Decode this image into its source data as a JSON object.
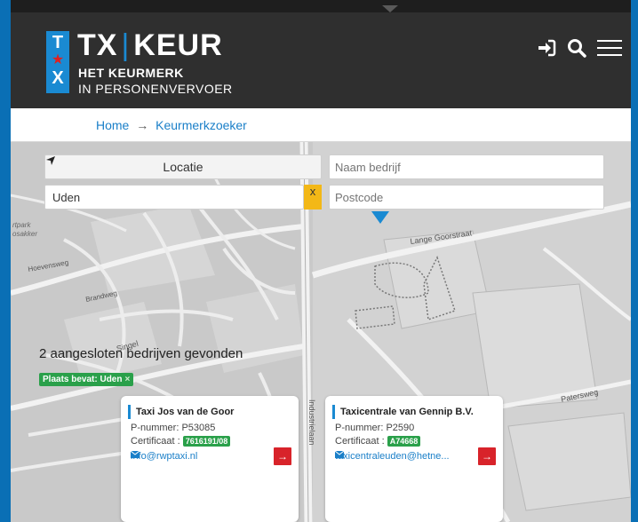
{
  "header": {
    "logo_t": "T",
    "logo_x": "X",
    "brand_left": "TX",
    "brand_sep": "|",
    "brand_right": "KEUR",
    "tagline_1": "HET KEURMERK",
    "tagline_2": "IN PERSONENVERVOER",
    "icons": [
      "login-icon",
      "search-icon",
      "hamburger-menu-icon"
    ]
  },
  "breadcrumb": {
    "home": "Home",
    "arrow": "→",
    "current": "Keurmerkzoeker"
  },
  "search": {
    "locatie_label": "Locatie",
    "naam_placeholder": "Naam bedrijf",
    "plaats_value": "Uden",
    "clear_label": "x",
    "postcode_placeholder": "Postcode"
  },
  "results": {
    "count_text": "2 aangesloten bedrijven gevonden",
    "filter_label": "Plaats bevat: Uden",
    "filter_remove": "×"
  },
  "map_labels": {
    "lange_goorstraat": "Lange Goorstraat",
    "industrielaan": "Industrielaan",
    "hoevensweg": "Hoevensweg",
    "patersweg": "Patersweg",
    "singel": "Singel",
    "brandweg": "Brandweg",
    "park": "rtpark",
    "bosakker": "osakker"
  },
  "companies": [
    {
      "name": "Taxi Jos van de Goor",
      "pnummer": "P-nummer: P53085",
      "cert_label": "Certificaat :",
      "cert_value": "7616191/08",
      "email": "info@rwptaxi.nl",
      "go_label": "→"
    },
    {
      "name": "Taxicentrale van Gennip B.V.",
      "pnummer": "P-nummer: P2590",
      "cert_label": "Certificaat :",
      "cert_value": "A74668",
      "email": "taxicentraleuden@hetne...",
      "go_label": "→"
    }
  ],
  "colors": {
    "accent_blue": "#1a8ad2",
    "header_bg": "#2f2f2f",
    "badge_green": "#2aa04a",
    "clear_yellow": "#f3b817",
    "go_red": "#d8232a"
  }
}
